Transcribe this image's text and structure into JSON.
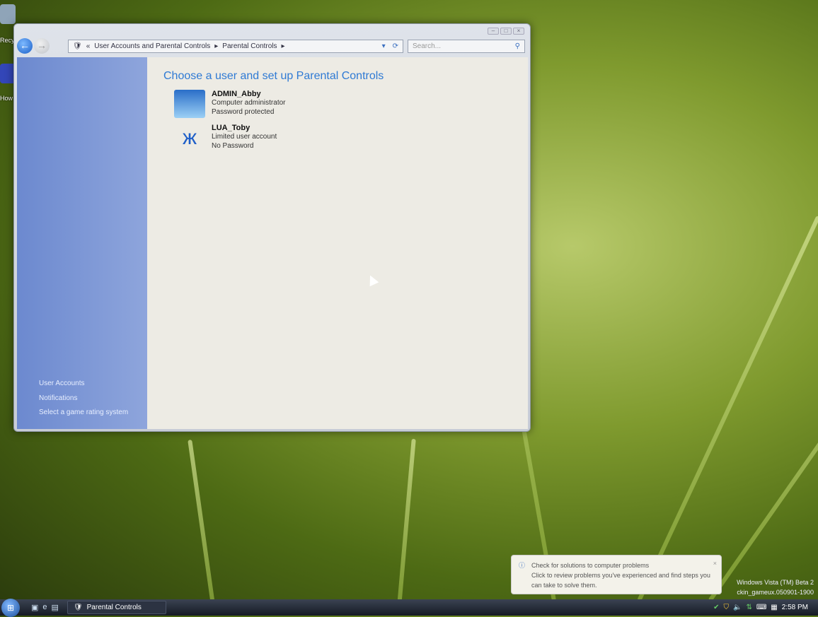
{
  "desktop": {
    "icon_labels": [
      "Recycle Bin",
      "How to"
    ]
  },
  "window": {
    "address": [
      "User Accounts and Parental Controls",
      "Parental Controls"
    ],
    "search_placeholder": "Search...",
    "sidebar": [
      "User Accounts",
      "Notifications",
      "Select a game rating system"
    ],
    "title": "Choose a user and set up Parental Controls",
    "users": [
      {
        "name": "ADMIN_Abby",
        "type": "Computer administrator",
        "password": "Password protected"
      },
      {
        "name": "LUA_Toby",
        "type": "Limited user account",
        "password": "No Password"
      }
    ]
  },
  "notification": {
    "title": "Check for solutions to computer problems",
    "body": "Click to review problems you've experienced and find steps you can take to solve them."
  },
  "watermark": {
    "line1": "Windows Vista (TM) Beta 2",
    "line2": "ckin_gameux.050901-1900"
  },
  "taskbar": {
    "task": "Parental Controls",
    "clock": "2:58 PM"
  }
}
